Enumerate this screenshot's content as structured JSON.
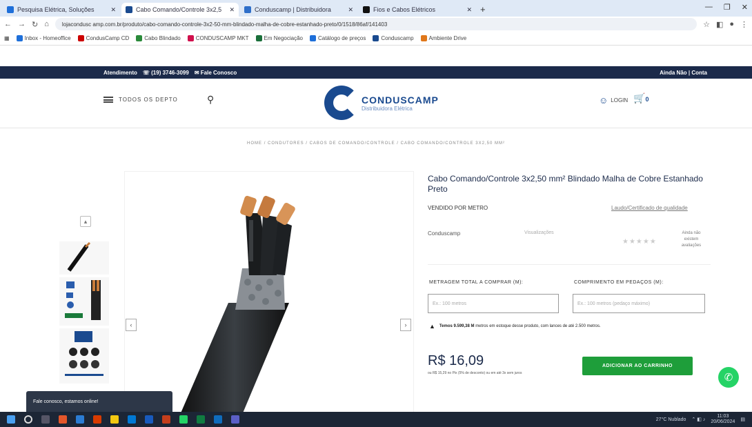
{
  "browser": {
    "tabs": [
      {
        "label": "Pesquisa Elétrica, Soluções",
        "color": "#1e6fd9",
        "active": false
      },
      {
        "label": "Cabo Comando/Controle 3x2,5",
        "color": "#1a4a8f",
        "active": true
      },
      {
        "label": "Conduscamp | Distribuidora",
        "color": "#2f6fc9",
        "active": false
      },
      {
        "label": "Fios e Cabos Elétricos",
        "color": "#111111",
        "active": false
      }
    ],
    "url": "lojacondusc amp.com.br/produto/cabo-comando-controle-3x2-50-mm-blindado-malha-de-cobre-estanhado-preto/0/1518/86af/141403",
    "bookmarks": [
      "Inbox - Homeoffice",
      "CondusCamp CD",
      "Cabo Blindado",
      "CONDUSCAMP MKT",
      "Em Negociação",
      "Catálogo de preços",
      "Conduscamp",
      "Ambiente Drive"
    ]
  },
  "site": {
    "topbar": {
      "atendimento": "Atendimento",
      "phone": "(19) 3746-3099",
      "fale": "Fale Conosco",
      "right": "Ainda Não | Conta"
    },
    "menu_label": "TODOS OS DEPTO",
    "logo_name": "CONDUSCAMP",
    "logo_sub": "Distribuidora Elétrica",
    "login_label": "LOGIN",
    "cart_count": "0",
    "breadcrumb": "HOME  /  CONDUTORES  /  CABOS DE COMANDO/CONTROLE  /  CABO COMANDO/CONTROLE 3X2,50 MM²"
  },
  "product": {
    "title": "Cabo Comando/Controle 3x2,50 mm² Blindado Malha de Cobre Estanhado Preto",
    "vendido": "VENDIDO POR METRO",
    "cert_link": "Laudo/Certificado de qualidade",
    "compr_label": "Conduscamp",
    "vis_label": "Visualizações",
    "reviews": "Ainda não existem avaliações",
    "label_metragem": "METRAGEM TOTAL A COMPRAR (M):",
    "label_comprimento": "COMPRIMENTO EM PEDAÇOS (M):",
    "ph_metragem": "Ex.: 100 metros",
    "ph_comprimento": "Ex.: 100 metros (pedaço máximo)",
    "warning_bold": "Temos 9.599,38 M",
    "warning_rest": "metros em estoque desse produto, com lances de até 2.500 metros.",
    "price": "R$ 16,09",
    "price_sub": "ou R$ 15,29 no Pix (5% de desconto) ou em até 3x sem juros",
    "add_button": "ADICIONAR AO CARRINHO",
    "chat_text": "Fale conosco, estamos online!"
  },
  "taskbar": {
    "weather": "27°C  Nublado",
    "time": "11:03",
    "date": "20/06/2024"
  }
}
